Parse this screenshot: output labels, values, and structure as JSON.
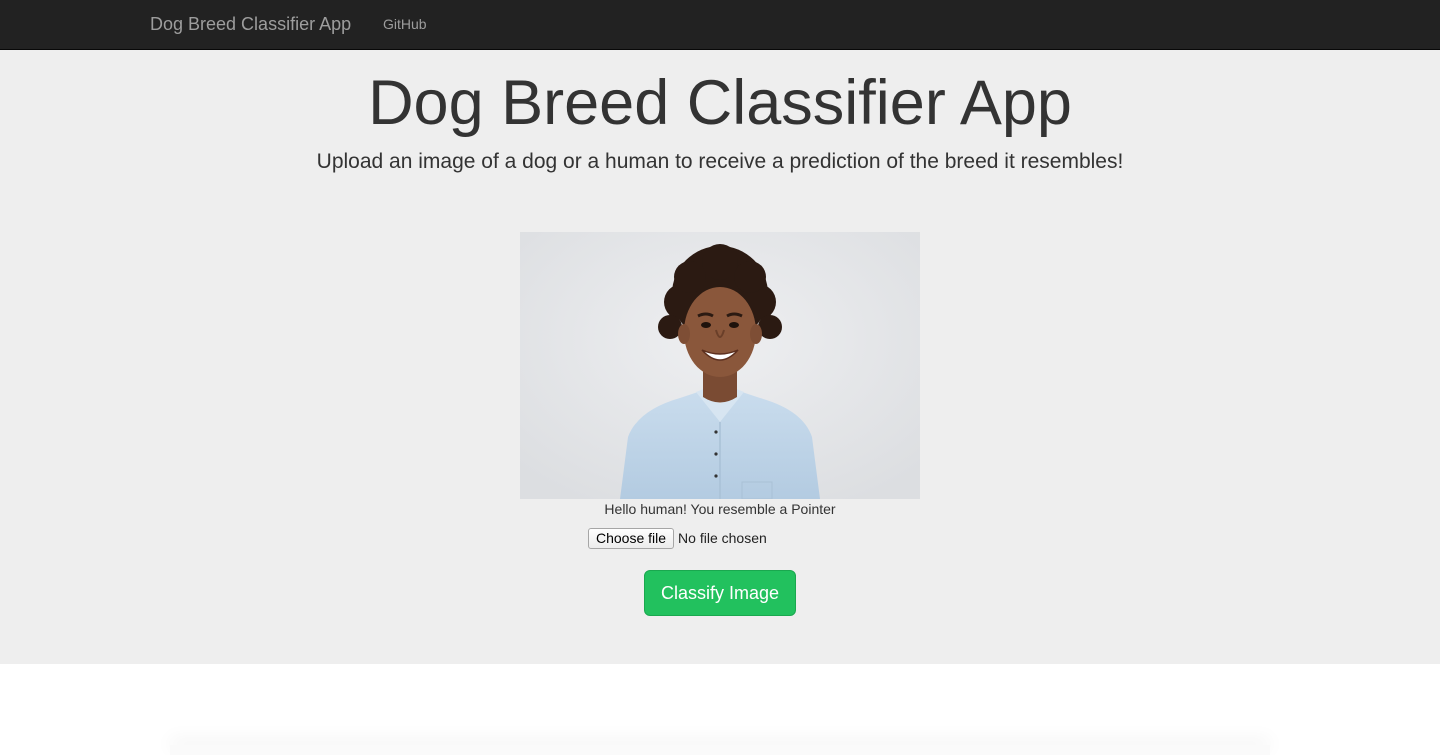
{
  "navbar": {
    "brand": "Dog Breed Classifier App",
    "links": [
      {
        "label": "GitHub"
      }
    ]
  },
  "hero": {
    "title": "Dog Breed Classifier App",
    "subtitle": "Upload an image of a dog or a human to receive a prediction of the breed it resembles!"
  },
  "result": {
    "image_alt": "uploaded-photo-smiling-man",
    "caption": "Hello human! You resemble a Pointer"
  },
  "upload": {
    "choose_label": "Choose file",
    "status": "No file chosen"
  },
  "actions": {
    "classify_label": "Classify Image"
  },
  "colors": {
    "navbar_bg": "#222222",
    "jumbotron_bg": "#eeeeee",
    "classify_btn": "#22c15e"
  }
}
